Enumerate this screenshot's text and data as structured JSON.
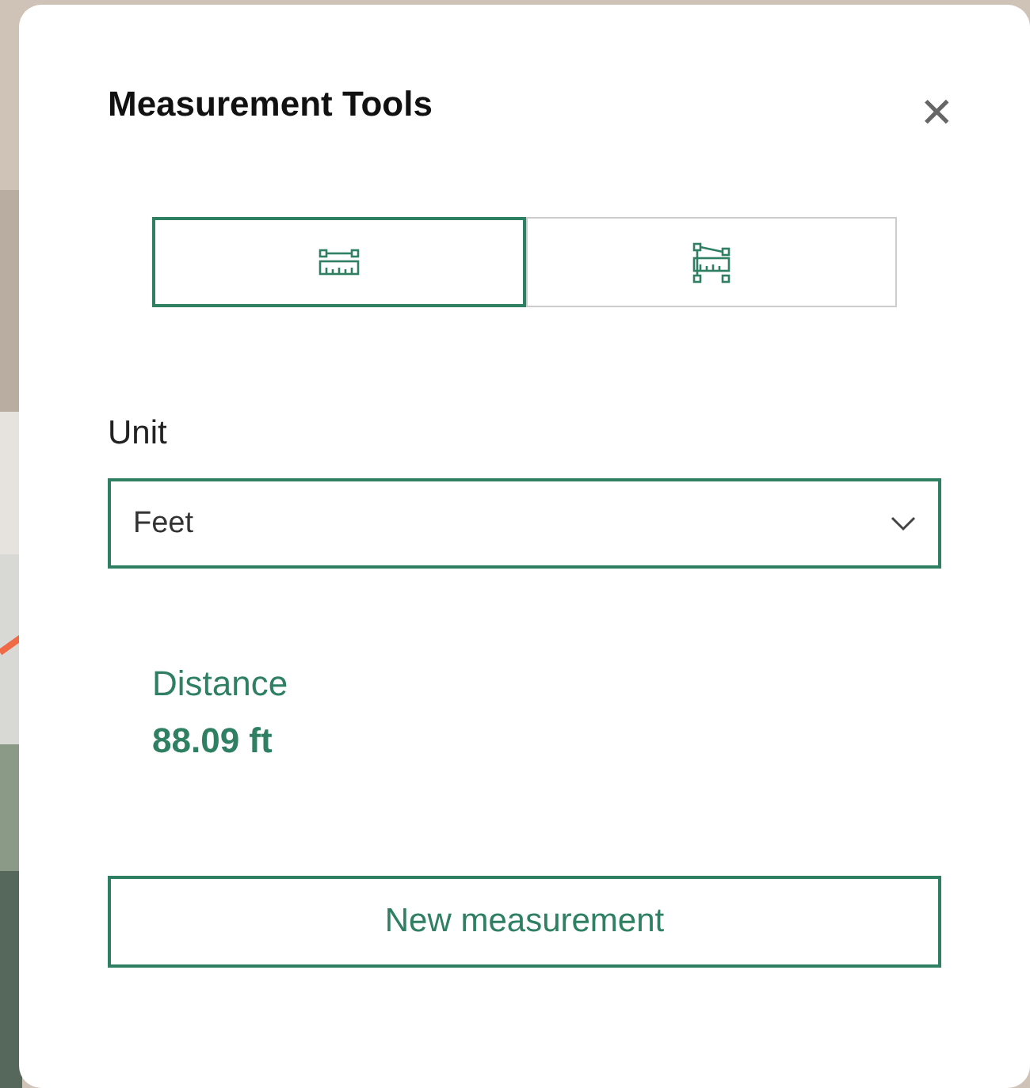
{
  "panel": {
    "title": "Measurement Tools",
    "close": "✕",
    "tools": [
      {
        "kind": "distance",
        "selected": true
      },
      {
        "kind": "area",
        "selected": false
      }
    ],
    "unit": {
      "label": "Unit",
      "value": "Feet"
    },
    "result": {
      "label": "Distance",
      "value": "88.09 ft"
    },
    "button": "New measurement"
  }
}
